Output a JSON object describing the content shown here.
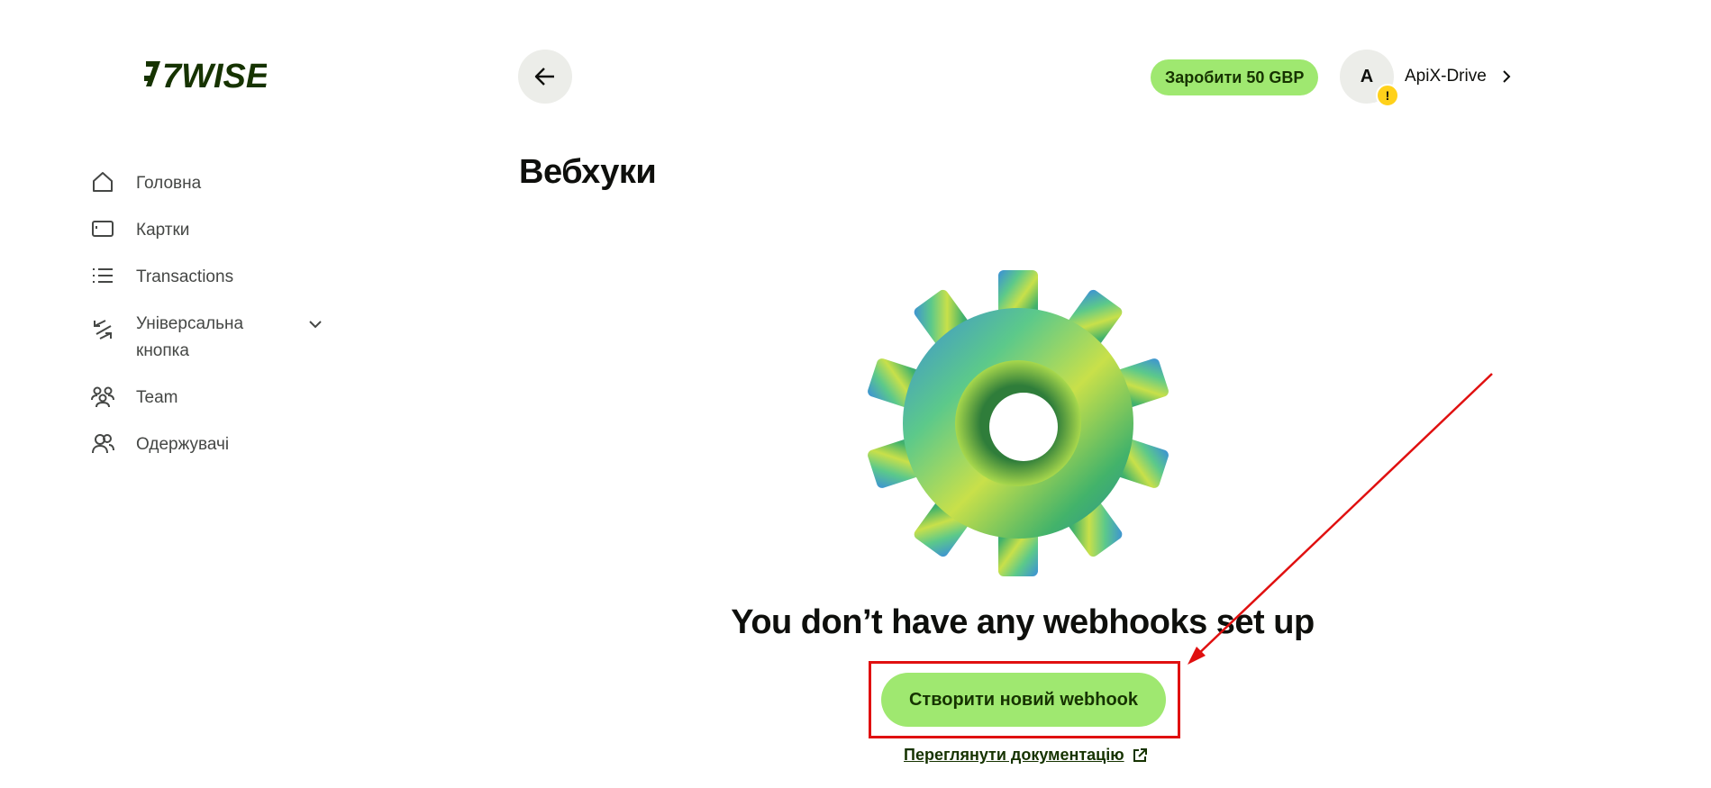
{
  "brand": {
    "logo_text": "7WISE",
    "color": "#163300"
  },
  "sidebar": {
    "items": [
      {
        "label": "Головна",
        "icon": "home-icon"
      },
      {
        "label": "Картки",
        "icon": "card-icon"
      },
      {
        "label": "Transactions",
        "icon": "list-icon"
      },
      {
        "label": "Універсальна кнопка",
        "icon": "convert-arrows-icon",
        "expandable": true
      },
      {
        "label": "Team",
        "icon": "team-icon"
      },
      {
        "label": "Одержувачі",
        "icon": "recipients-icon"
      }
    ]
  },
  "header": {
    "earn_label": "Заробити 50 GBP",
    "avatar_initial": "A",
    "warning_badge": "!",
    "account_name": "ApiX-Drive"
  },
  "page": {
    "title": "Вебхуки",
    "empty_title": "You don’t have any webhooks set up",
    "create_button": "Створити новий webhook",
    "docs_link": "Переглянути документацію"
  },
  "colors": {
    "accent": "#9fe870",
    "accent_text": "#163300",
    "annotation": "#e01010",
    "warning": "#ffd11a"
  }
}
